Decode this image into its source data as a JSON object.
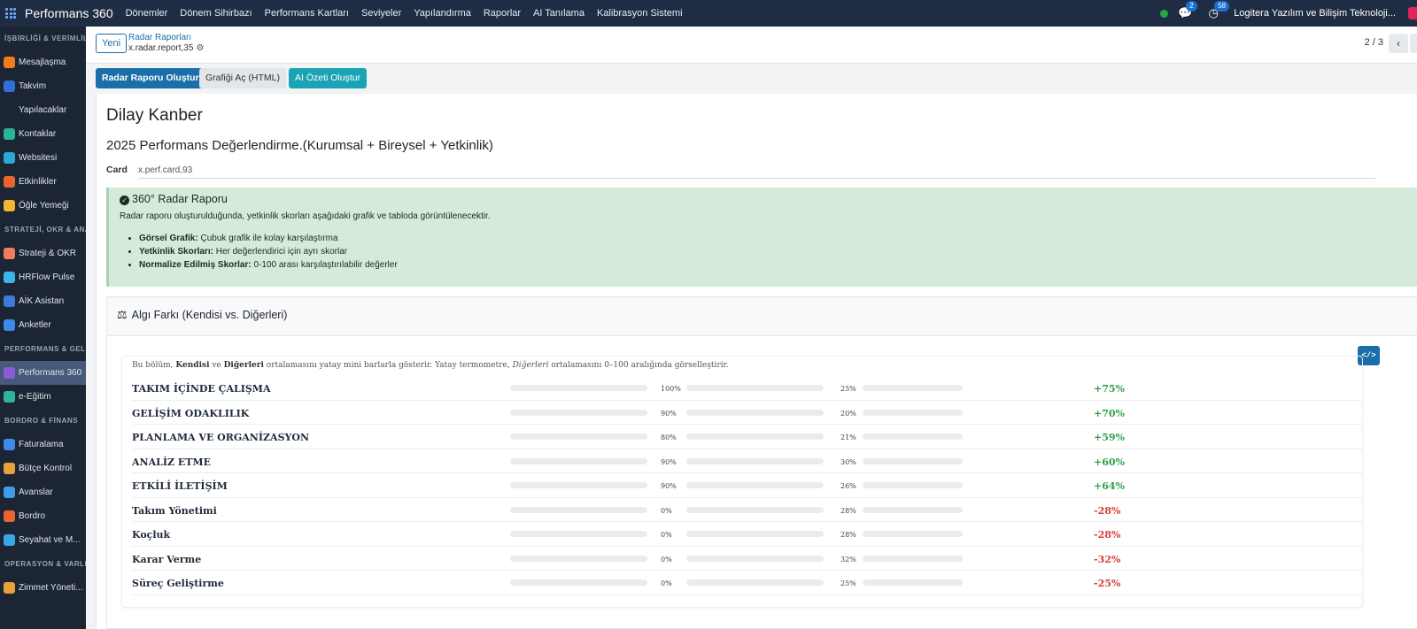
{
  "topbar": {
    "brand": "Performans 360",
    "menu": [
      "Dönemler",
      "Dönem Sihirbazı",
      "Performans Kartları",
      "Seviyeler",
      "Yapılandırma",
      "Raporlar",
      "AI Tanılama",
      "Kalibrasyon Sistemi"
    ],
    "messages_count": "2",
    "activities_count": "58",
    "company": "Logitera Yazılım ve Bilişim Teknoloji..."
  },
  "sidebar": {
    "sections": [
      {
        "title": "İŞBİRLİĞİ & VERİMLİLİK",
        "items": [
          {
            "label": "Mesajlaşma",
            "color": "#f07c1c"
          },
          {
            "label": "Takvim",
            "color": "#2f6fd6",
            "glyph": "31"
          },
          {
            "label": "Yapılacaklar",
            "color": "#1c2534"
          },
          {
            "label": "Kontaklar",
            "color": "#2bb39a"
          },
          {
            "label": "Websitesi",
            "color": "#2aa8d8"
          },
          {
            "label": "Etkinlikler",
            "color": "#e8662d"
          },
          {
            "label": "Öğle Yemeği",
            "color": "#f2b631"
          }
        ]
      },
      {
        "title": "STRATEJİ, OKR & ANALİZ",
        "items": [
          {
            "label": "Strateji & OKR",
            "color": "#f07c5c"
          },
          {
            "label": "HRFlow Pulse",
            "color": "#39b6e8"
          },
          {
            "label": "AİK Asistan",
            "color": "#3d7bd8"
          },
          {
            "label": "Anketler",
            "color": "#3d8be8"
          }
        ]
      },
      {
        "title": "PERFORMANS & GELİŞİM",
        "items": [
          {
            "label": "Performans 360",
            "color": "#8a5cd8",
            "active": true
          },
          {
            "label": "e-Eğitim",
            "color": "#2bb3a0"
          }
        ]
      },
      {
        "title": "BORDRO & FİNANS",
        "items": [
          {
            "label": "Faturalama",
            "color": "#3d8be8"
          },
          {
            "label": "Bütçe Kontrol",
            "color": "#e8a03d"
          },
          {
            "label": "Avanslar",
            "color": "#3d9be8"
          },
          {
            "label": "Bordro",
            "color": "#e8662d"
          },
          {
            "label": "Seyahat ve M...",
            "color": "#39a6e8"
          }
        ]
      },
      {
        "title": "OPERASYON & VARLIK",
        "items": [
          {
            "label": "Zimmet Yöneti...",
            "color": "#e8a03d"
          }
        ]
      }
    ]
  },
  "control": {
    "new_label": "Yeni",
    "breadcrumb_parent": "Radar Raporları",
    "breadcrumb_record": "x.radar.report,35",
    "pager": "2 / 3"
  },
  "actions": {
    "create_report": "Radar Raporu Oluştur",
    "open_chart": "Grafiği Aç (HTML)",
    "ai_summary": "AI Özeti Oluştur"
  },
  "form": {
    "employee": "Dilay Kanber",
    "card_title": "2025 Performans Değerlendirme.(Kurumsal + Bireysel + Yetkinlik)",
    "card_label": "Card",
    "card_value": "x.perf.card,93"
  },
  "alert": {
    "title": "360° Radar Raporu",
    "description": "Radar raporu oluşturulduğunda, yetkinlik skorları aşağıdaki grafik ve tabloda görüntülenecektir.",
    "items": [
      {
        "bold": "Görsel Grafik:",
        "text": " Çubuk grafik ile kolay karşılaştırma"
      },
      {
        "bold": "Yetkinlik Skorları:",
        "text": " Her değerlendirici için ayrı skorlar"
      },
      {
        "bold": "Normalize Edilmiş Skorlar:",
        "text": " 0-100 arası karşılaştırılabilir değerler"
      }
    ]
  },
  "perception": {
    "title": "Algı Farkı (Kendisi vs. Diğerleri)",
    "code_label": "</>",
    "intro": {
      "p1": "Bu bölüm, ",
      "b1": "Kendisi",
      "p2": " ve ",
      "b2": "Diğerleri",
      "p3": " ortalamasını yatay mini barlarla gösterir. Yatay termometre, ",
      "i1": "Diğerleri",
      "p4": " ortalamasını 0–100 aralığında görselleştirir."
    },
    "rows": [
      {
        "label": "TAKIM İÇİNDE ÇALIŞMA",
        "self": 100,
        "self_text": "100%",
        "others": 25,
        "others_text": "25%",
        "diff": "+75%",
        "positive": true
      },
      {
        "label": "GELİŞİM ODAKLILIK",
        "self": 90,
        "self_text": "90%",
        "others": 20,
        "others_text": "20%",
        "diff": "+70%",
        "positive": true
      },
      {
        "label": "PLANLAMA VE ORGANİZASYON",
        "self": 80,
        "self_text": "80%",
        "others": 21,
        "others_text": "21%",
        "diff": "+59%",
        "positive": true
      },
      {
        "label": "ANALİZ ETME",
        "self": 90,
        "self_text": "90%",
        "others": 30,
        "others_text": "30%",
        "diff": "+60%",
        "positive": true
      },
      {
        "label": "ETKİLİ İLETİŞİM",
        "self": 90,
        "self_text": "90%",
        "others": 26,
        "others_text": "26%",
        "diff": "+64%",
        "positive": true
      },
      {
        "label": "Takım Yönetimi",
        "self": 0,
        "self_text": "0%",
        "others": 28,
        "others_text": "28%",
        "diff": "-28%",
        "positive": false
      },
      {
        "label": "Koçluk",
        "self": 0,
        "self_text": "0%",
        "others": 28,
        "others_text": "28%",
        "diff": "-28%",
        "positive": false
      },
      {
        "label": "Karar Verme",
        "self": 0,
        "self_text": "0%",
        "others": 32,
        "others_text": "32%",
        "diff": "-32%",
        "positive": false
      },
      {
        "label": "Süreç Geliştirme",
        "self": 0,
        "self_text": "0%",
        "others": 25,
        "others_text": "25%",
        "diff": "-25%",
        "positive": false
      }
    ]
  }
}
